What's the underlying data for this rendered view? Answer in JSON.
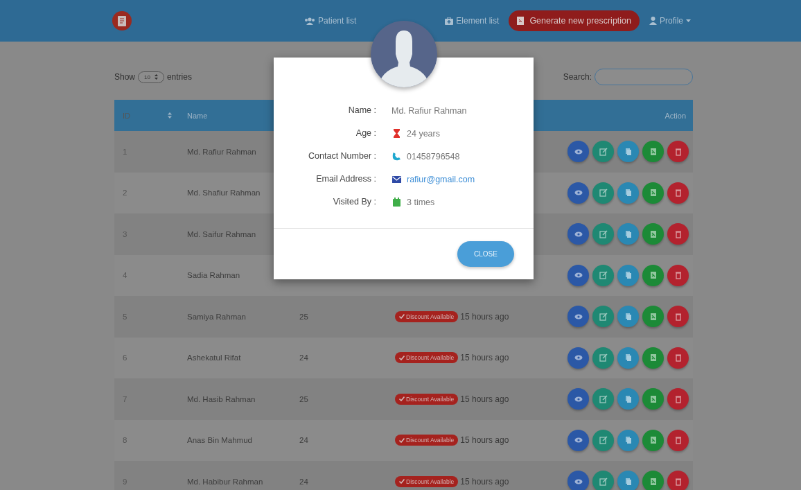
{
  "navbar": {
    "links": [
      {
        "label": "Patient list",
        "kind": "users"
      },
      {
        "label": "Element list",
        "kind": "kit"
      }
    ],
    "primary_button": "Generate new prescription",
    "profile": "Profile"
  },
  "table_controls": {
    "show_label": "Show",
    "page_size": "10",
    "entries_label": "entries",
    "search_label": "Search:"
  },
  "table": {
    "columns": [
      "ID",
      "Name",
      "Action"
    ],
    "rows": [
      {
        "id": "1",
        "name": "Md. Rafiur Rahman"
      },
      {
        "id": "2",
        "name": "Md. Shafiur Rahman"
      },
      {
        "id": "3",
        "name": "Md. Saifur Rahman"
      },
      {
        "id": "4",
        "name": "Sadia Rahman"
      },
      {
        "id": "5",
        "name": "Samiya Rahman",
        "age": "25",
        "badge": "Discount Available",
        "time": "15 hours ago"
      },
      {
        "id": "6",
        "name": "Ashekatul Rifat",
        "age": "24",
        "badge": "Discount Available",
        "time": "15 hours ago"
      },
      {
        "id": "7",
        "name": "Md. Hasib Rahman",
        "age": "25",
        "badge": "Discount Available",
        "time": "15 hours ago"
      },
      {
        "id": "8",
        "name": "Anas Bin Mahmud",
        "age": "24",
        "badge": "Discount Available",
        "time": "15 hours ago"
      },
      {
        "id": "9",
        "name": "Md. Habibur Rahman",
        "age": "24",
        "badge": "Discount Available",
        "time": "15 hours ago"
      }
    ]
  },
  "modal": {
    "fields": [
      {
        "label": "Name :",
        "value": "Md. Rafiur Rahman",
        "kind": "text"
      },
      {
        "label": "Age :",
        "value": "24 years",
        "kind": "age"
      },
      {
        "label": "Contact Number :",
        "value": "01458796548",
        "kind": "phone"
      },
      {
        "label": "Email Address :",
        "value": "rafiur@gmail.com",
        "kind": "email"
      },
      {
        "label": "Visited By :",
        "value": "3 times",
        "kind": "visits"
      }
    ],
    "close_button": "CLOSE"
  }
}
